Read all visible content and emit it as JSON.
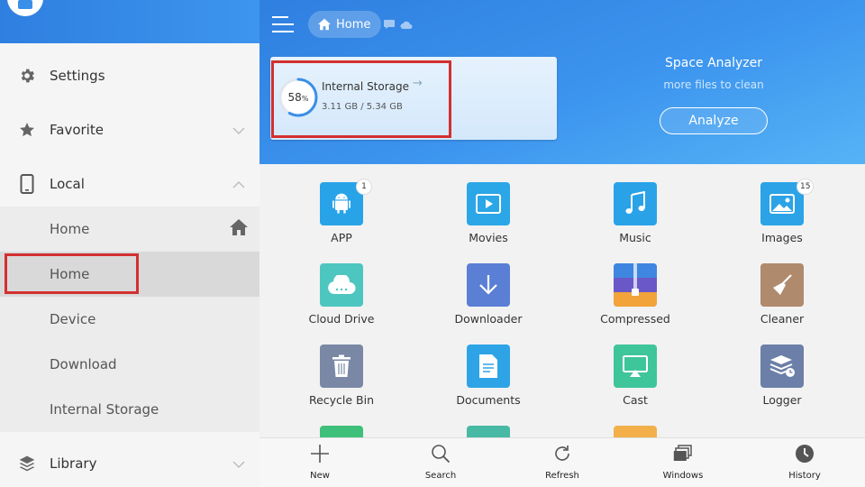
{
  "sidebar": {
    "items": [
      {
        "label": "Settings",
        "icon": "gear-icon"
      },
      {
        "label": "Favorite",
        "icon": "star-icon"
      },
      {
        "label": "Local",
        "icon": "phone-icon"
      },
      {
        "label": "Library",
        "icon": "layers-icon"
      }
    ],
    "local_sub": [
      "Home",
      "Home",
      "Device",
      "Download",
      "Internal Storage"
    ]
  },
  "header": {
    "breadcrumb": "Home"
  },
  "storage": {
    "name": "Internal Storage",
    "percent_value": 58,
    "percent": "58",
    "percent_unit": "%",
    "size": "3.11 GB / 5.34 GB"
  },
  "analyzer": {
    "title": "Space Analyzer",
    "subtitle": "more files to clean",
    "button": "Analyze"
  },
  "grid": [
    {
      "label": "APP",
      "icon": "android-icon",
      "color": "#29a3e8",
      "badge": "1"
    },
    {
      "label": "Movies",
      "icon": "video-icon",
      "color": "#2ba6e6",
      "badge": ""
    },
    {
      "label": "Music",
      "icon": "music-icon",
      "color": "#2aa2e8",
      "badge": ""
    },
    {
      "label": "Images",
      "icon": "image-icon",
      "color": "#2ba3e6",
      "badge": "15"
    },
    {
      "label": "Cloud Drive",
      "icon": "cloud-icon",
      "color": "#4ec6c0",
      "badge": ""
    },
    {
      "label": "Downloader",
      "icon": "download-icon",
      "color": "#5a7fd4",
      "badge": ""
    },
    {
      "label": "Compressed",
      "icon": "zip-icon",
      "color": "#4a6fd0",
      "badge": ""
    },
    {
      "label": "Cleaner",
      "icon": "broom-icon",
      "color": "#b08a6c",
      "badge": ""
    },
    {
      "label": "Recycle Bin",
      "icon": "trash-icon",
      "color": "#7a88a6",
      "badge": ""
    },
    {
      "label": "Documents",
      "icon": "document-icon",
      "color": "#2ea4e6",
      "badge": ""
    },
    {
      "label": "Cast",
      "icon": "cast-icon",
      "color": "#3fc59a",
      "badge": ""
    },
    {
      "label": "Logger",
      "icon": "logger-icon",
      "color": "#6b7fa8",
      "badge": ""
    }
  ],
  "bottom": [
    {
      "label": "New",
      "icon": "plus-icon"
    },
    {
      "label": "Search",
      "icon": "search-icon"
    },
    {
      "label": "Refresh",
      "icon": "refresh-icon"
    },
    {
      "label": "Windows",
      "icon": "windows-icon"
    },
    {
      "label": "History",
      "icon": "clock-icon"
    }
  ],
  "colors": {
    "accent": "#3a8fe8",
    "highlight": "#d32f2f"
  }
}
